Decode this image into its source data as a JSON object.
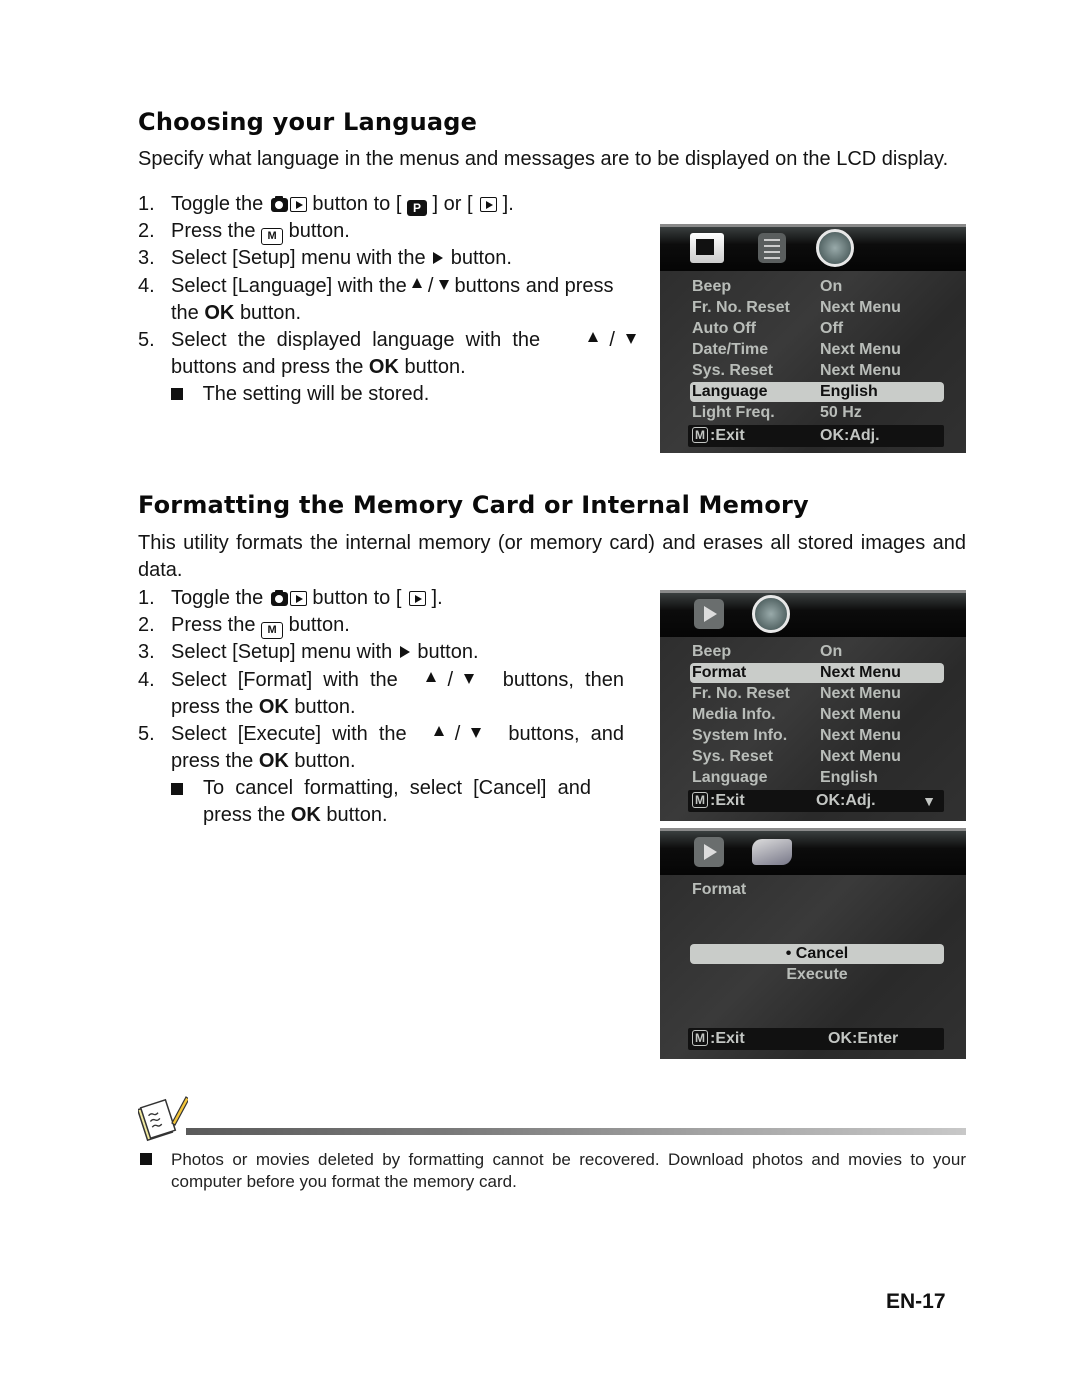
{
  "section1": {
    "title": "Choosing your Language",
    "intro": "Specify what language in the menus and messages are to be displayed on the LCD display.",
    "steps": [
      {
        "num": "1.",
        "pre": "Toggle the",
        "mid": "button to [",
        "mid2": "] or [",
        "post": "]."
      },
      {
        "num": "2.",
        "pre": "Press the",
        "post": "button."
      },
      {
        "num": "3.",
        "pre": "Select [Setup] menu with the",
        "post": "button."
      },
      {
        "num": "4.",
        "pre": "Select [Language] with the",
        "slash": "/",
        "post": "buttons and press",
        "line2_pre": "the",
        "ok": "OK",
        "line2_post": "button."
      },
      {
        "num": "5.",
        "pre": "Select  the  displayed  language  with  the",
        "slash": "/",
        "line2_pre": "buttons and press the",
        "ok": "OK",
        "line2_post": "button."
      }
    ],
    "note": "The setting will be stored.",
    "lcd": {
      "tabs": [
        "camera-mode-icon",
        "list-menu-icon",
        "setup-wrench-icon"
      ],
      "rows": [
        {
          "key": "Beep",
          "value": "On"
        },
        {
          "key": "Fr. No. Reset",
          "value": "Next Menu"
        },
        {
          "key": "Auto Off",
          "value": "Off"
        },
        {
          "key": "Date/Time",
          "value": "Next Menu"
        },
        {
          "key": "Sys. Reset",
          "value": "Next Menu"
        },
        {
          "key": "Language",
          "value": "English",
          "selected": true
        },
        {
          "key": "Light Freq.",
          "value": "50 Hz"
        }
      ],
      "footer_key": "M",
      "footer_left": ":Exit",
      "footer_right": "OK:Adj."
    }
  },
  "section2": {
    "title": "Formatting the Memory Card or Internal Memory",
    "intro": "This utility formats the internal memory (or memory card) and erases all stored images and data.",
    "steps": [
      {
        "num": "1.",
        "pre": "Toggle the",
        "mid": "button to [",
        "post": "]."
      },
      {
        "num": "2.",
        "pre": "Press the",
        "post": "button."
      },
      {
        "num": "3.",
        "pre": "Select [Setup] menu with",
        "post": "button."
      },
      {
        "num": "4.",
        "pre": "Select  [Format]  with  the",
        "slash": "/",
        "post": "buttons,  then",
        "line2_pre": "press the",
        "ok": "OK",
        "line2_post": "button."
      },
      {
        "num": "5.",
        "pre": "Select  [Execute]  with  the",
        "slash": "/",
        "post": "buttons,  and",
        "line2_pre": "press the",
        "ok": "OK",
        "line2_post": "button."
      }
    ],
    "note": "To  cancel  formatting,  select  [Cancel]  and",
    "note_line2_pre": "press the",
    "note_ok": "OK",
    "note_line2_post": "button.",
    "lcd_menu": {
      "tabs": [
        "playback-mode-icon",
        "setup-wrench-icon"
      ],
      "rows": [
        {
          "key": "Beep",
          "value": "On"
        },
        {
          "key": "Format",
          "value": "Next Menu",
          "selected": true
        },
        {
          "key": "Fr. No. Reset",
          "value": "Next Menu"
        },
        {
          "key": "Media Info.",
          "value": "Next Menu"
        },
        {
          "key": "System Info.",
          "value": "Next Menu"
        },
        {
          "key": "Sys. Reset",
          "value": "Next Menu"
        },
        {
          "key": "Language",
          "value": "English"
        }
      ],
      "footer_key": "M",
      "footer_left": ":Exit",
      "footer_right": "OK:Adj.",
      "scroll_indicator": "▼"
    },
    "lcd_confirm": {
      "tabs": [
        "playback-mode-icon",
        "setup-wrench-icon"
      ],
      "heading": "Format",
      "options": [
        {
          "label": "• Cancel",
          "selected": true
        },
        {
          "label": "Execute"
        }
      ],
      "footer_key": "M",
      "footer_left": ":Exit",
      "footer_right": "OK:Enter"
    }
  },
  "note_box": {
    "icon": "notepad-pencil-icon",
    "text": "Photos or movies deleted by formatting cannot be recovered. Download photos and movies to your computer before you format the memory card."
  },
  "page_number": "EN-17"
}
